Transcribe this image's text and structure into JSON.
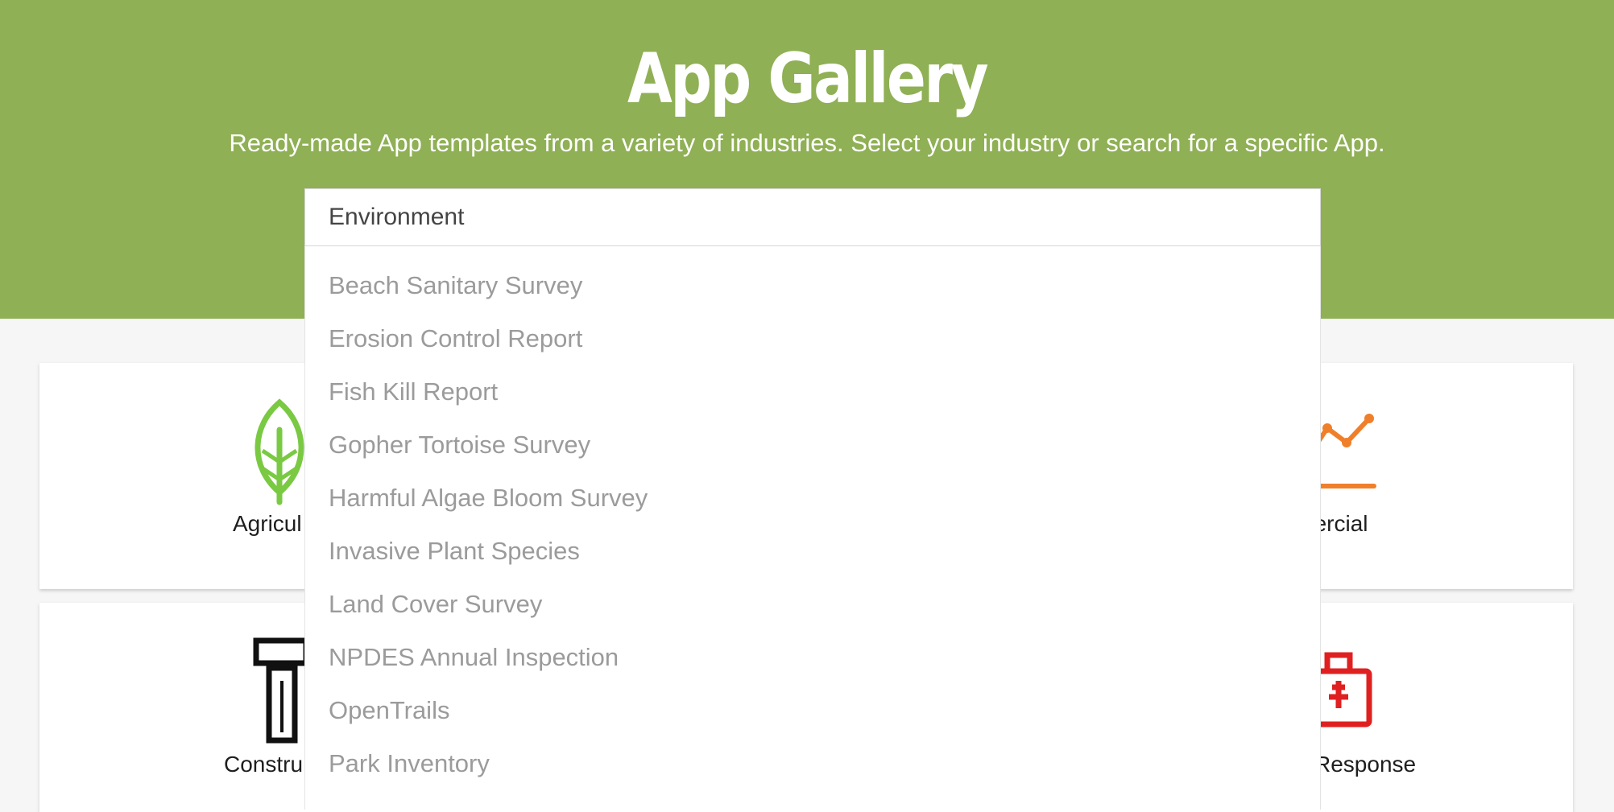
{
  "header": {
    "title": "App Gallery",
    "subtitle": "Ready-made App templates from a variety of industries. Select your industry or search for a specific App."
  },
  "search": {
    "selected": "Environment",
    "options": [
      "Beach Sanitary Survey",
      "Erosion Control Report",
      "Fish Kill Report",
      "Gopher Tortoise Survey",
      "Harmful Algae Bloom Survey",
      "Invasive Plant Species",
      "Land Cover Survey",
      "NPDES Annual Inspection",
      "OpenTrails",
      "Park Inventory"
    ]
  },
  "categories": [
    {
      "label": "Agricul",
      "icon": "leaf-icon",
      "color": "#7ac943"
    },
    {
      "label": "nercial",
      "icon": "chart-line-icon",
      "color": "#f07f2a"
    },
    {
      "label": "Constru",
      "icon": "construction-icon",
      "color": "#111111"
    },
    {
      "label": "Response",
      "icon": "first-aid-kit-icon",
      "color": "#e02020"
    }
  ],
  "colors": {
    "brand": "#8fb054",
    "background": "#f6f6f6",
    "option_text": "#9b9b9b"
  }
}
